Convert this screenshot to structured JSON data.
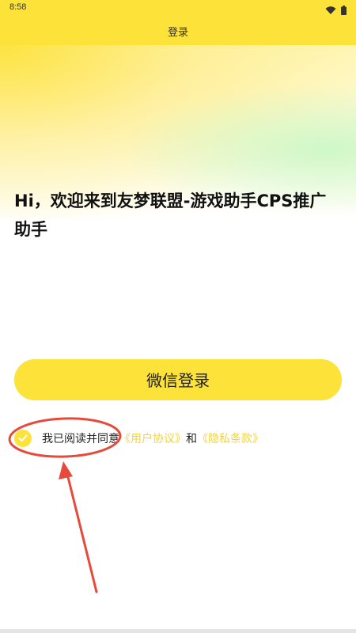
{
  "status_bar": {
    "time": "8:58",
    "icons": [
      "wifi-icon",
      "battery-icon"
    ]
  },
  "header": {
    "title": "登录"
  },
  "main": {
    "welcome_text": "Hi，欢迎来到友梦联盟-游戏助手CPS推广助手",
    "login_button": "微信登录"
  },
  "agreement": {
    "checked": true,
    "prefix": "我已阅读并同意",
    "user_agreement": "《用户协议》",
    "conjunction": "和",
    "privacy_policy": "《隐私条款》"
  },
  "colors": {
    "accent": "#fde23a",
    "link": "#f2d43a",
    "annotation": "#e64a3b"
  }
}
